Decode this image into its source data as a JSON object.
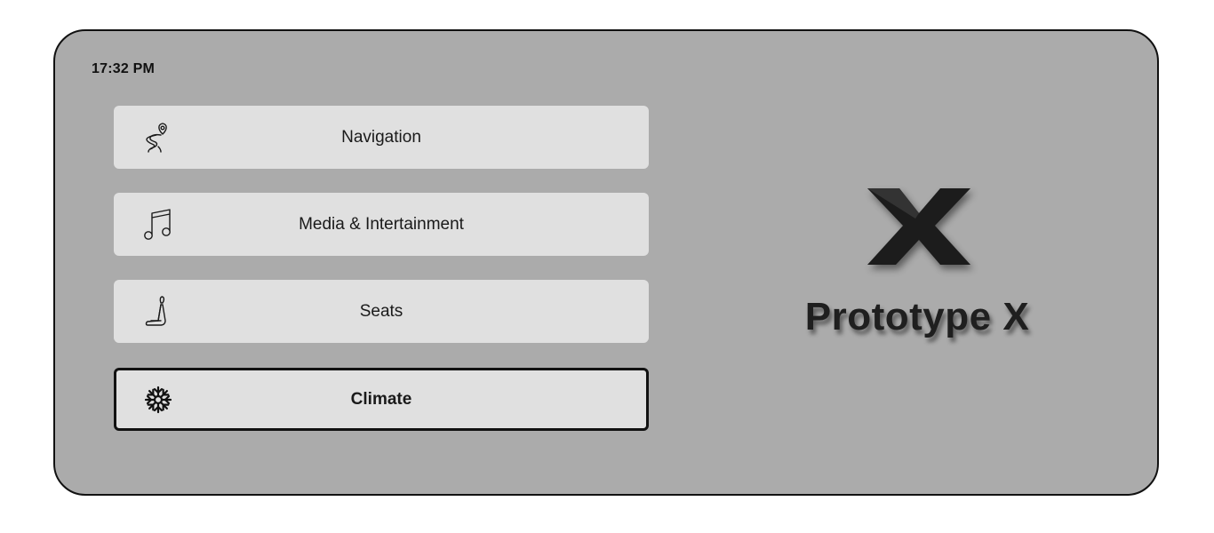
{
  "status": {
    "time": "17:32 PM"
  },
  "menu": {
    "items": [
      {
        "label": "Navigation",
        "icon": "route-pin-icon",
        "active": false
      },
      {
        "label": "Media & Intertainment",
        "icon": "music-note-icon",
        "active": false
      },
      {
        "label": "Seats",
        "icon": "car-seat-icon",
        "active": false
      },
      {
        "label": "Climate",
        "icon": "snowflake-icon",
        "active": true
      }
    ]
  },
  "brand": {
    "logo": "x-logo-icon",
    "name": "Prototype X"
  },
  "colors": {
    "panel_background": "#ababab",
    "button_background": "#e0e0e0",
    "active_border": "#111111",
    "text": "#1a1a1a"
  }
}
